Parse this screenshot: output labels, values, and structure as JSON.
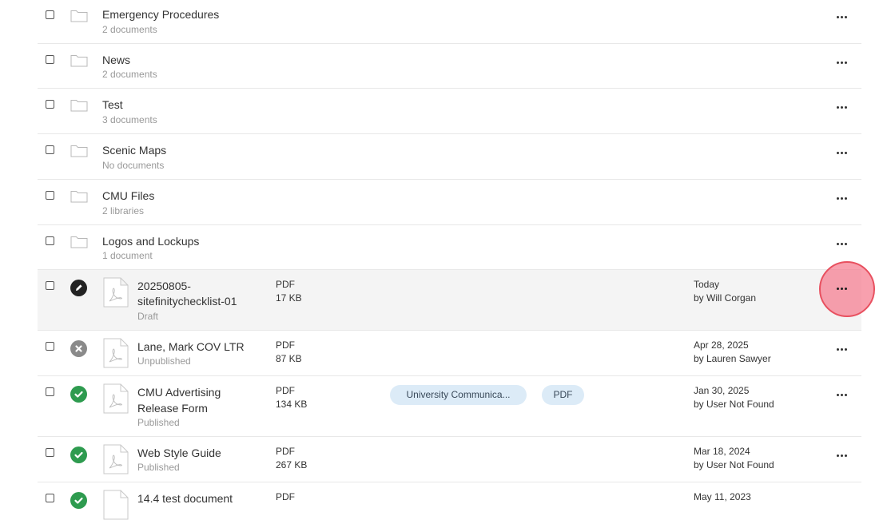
{
  "folders": [
    {
      "title": "Emergency Procedures",
      "sub": "2 documents"
    },
    {
      "title": "News",
      "sub": "2 documents"
    },
    {
      "title": "Test",
      "sub": "3 documents"
    },
    {
      "title": "Scenic Maps",
      "sub": "No documents"
    },
    {
      "title": "CMU Files",
      "sub": "2 libraries"
    },
    {
      "title": "Logos and Lockups",
      "sub": "1 document"
    }
  ],
  "documents": [
    {
      "title1": "20250805-",
      "title2": "sitefinitychecklist-01",
      "status": "Draft",
      "type": "PDF",
      "size": "17 KB",
      "date": "Today",
      "by": "by Will Corgan",
      "status_icon": "pencil-icon",
      "status_color": "#222222"
    },
    {
      "title1": "Lane, Mark COV LTR",
      "title2": "",
      "status": "Unpublished",
      "type": "PDF",
      "size": "87 KB",
      "date": "Apr 28, 2025",
      "by": "by Lauren Sawyer",
      "status_icon": "x-circle-icon",
      "status_color": "#888888"
    },
    {
      "title1": "CMU Advertising",
      "title2": "Release Form",
      "status": "Published",
      "type": "PDF",
      "size": "134 KB",
      "date": "Jan 30, 2025",
      "by": "by User Not Found",
      "status_icon": "check-circle-icon",
      "status_color": "#2e9b4f",
      "tags": [
        "University Communica...",
        "PDF"
      ]
    },
    {
      "title1": "Web Style Guide",
      "title2": "",
      "status": "Published",
      "type": "PDF",
      "size": "267 KB",
      "date": "Mar 18, 2024",
      "by": "by User Not Found",
      "status_icon": "check-circle-icon",
      "status_color": "#2e9b4f"
    },
    {
      "title1": "14.4 test document",
      "title2": "",
      "status": "",
      "type": "PDF",
      "size": "",
      "date": "May 11, 2023",
      "by": "",
      "status_icon": "check-circle-icon",
      "status_color": "#2e9b4f"
    }
  ]
}
